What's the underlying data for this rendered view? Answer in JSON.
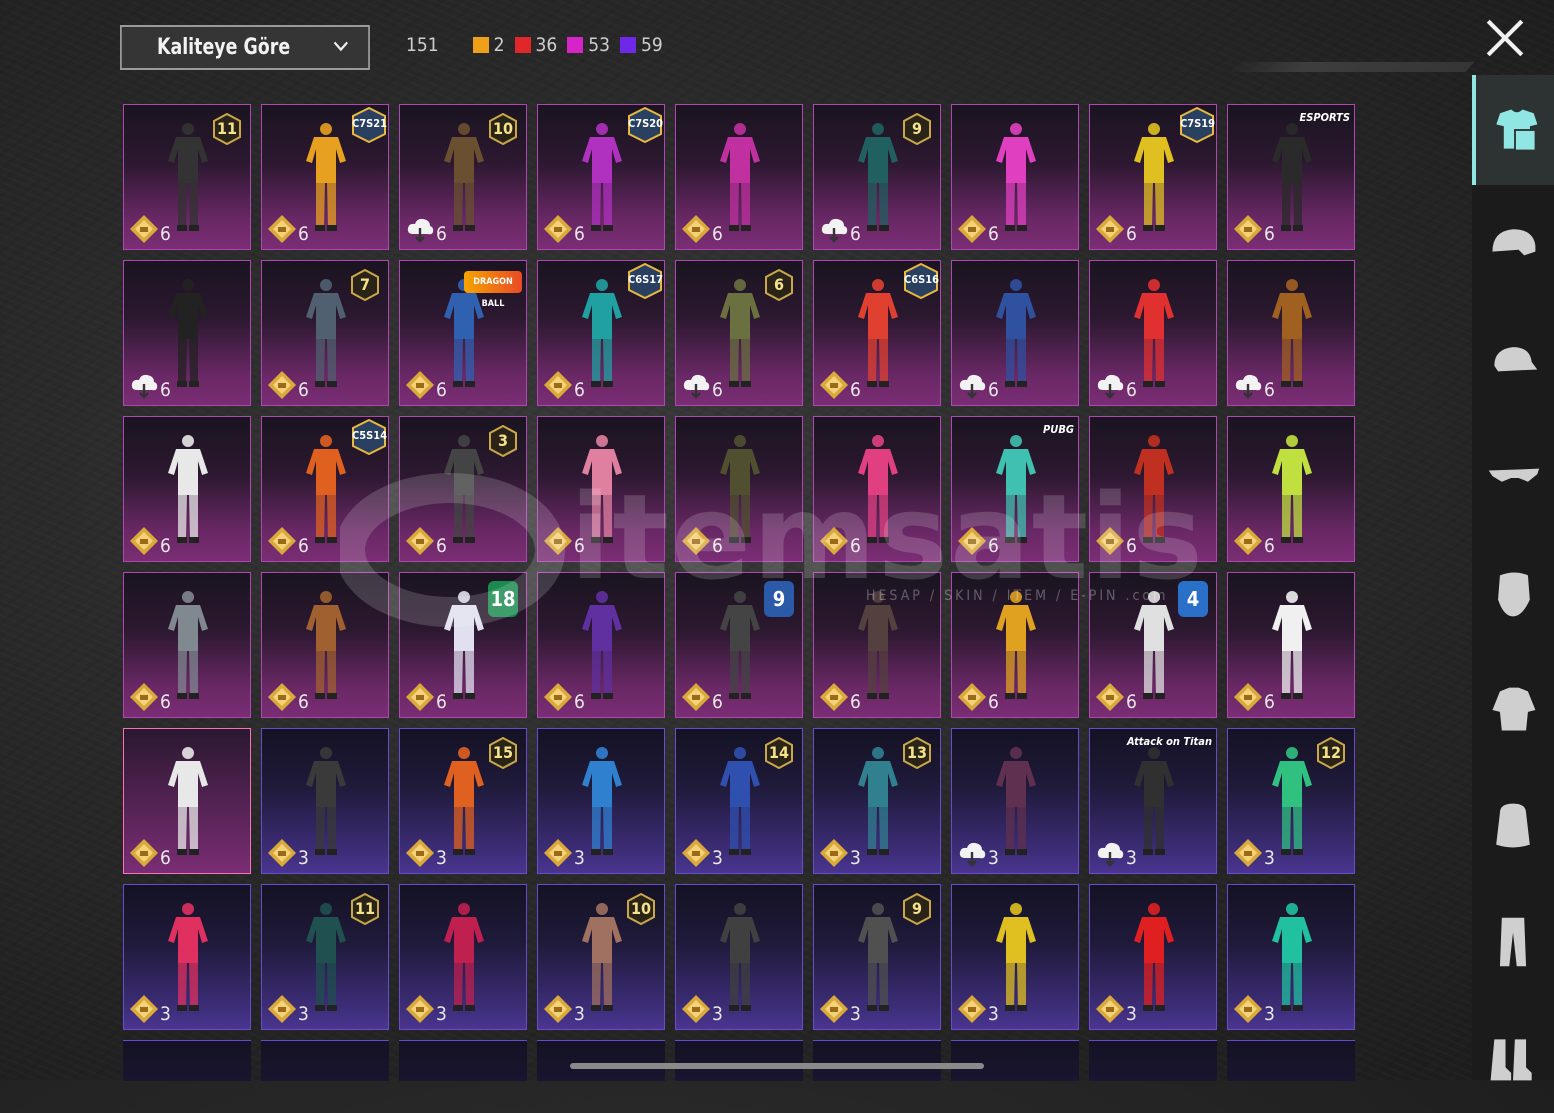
{
  "sort_dropdown": {
    "label": "Kaliteye Göre"
  },
  "counts": {
    "total": "151",
    "items": [
      {
        "value": "2",
        "color": "#f0a018"
      },
      {
        "value": "36",
        "color": "#e0282a"
      },
      {
        "value": "53",
        "color": "#d624c8"
      },
      {
        "value": "59",
        "color": "#7028e8"
      }
    ]
  },
  "watermark": {
    "brand": "itemsatis",
    "tagline": "HESAP / SKIN / ITEM / E-PIN .com"
  },
  "sidebar": {
    "items": [
      {
        "icon": "outfit-icon",
        "active": true
      },
      {
        "icon": "helmet-icon"
      },
      {
        "icon": "cap-icon"
      },
      {
        "icon": "glasses-icon"
      },
      {
        "icon": "mask-icon"
      },
      {
        "icon": "jacket-icon"
      },
      {
        "icon": "backpack-icon"
      },
      {
        "icon": "pants-icon"
      },
      {
        "icon": "shoes-icon"
      }
    ]
  },
  "tiles": [
    {
      "lvl": "6",
      "ind": "star",
      "rarity": "mythic",
      "badge": {
        "kind": "hex",
        "text": "11"
      },
      "color": "#333"
    },
    {
      "lvl": "6",
      "ind": "star",
      "rarity": "mythic",
      "badge": {
        "kind": "season",
        "text": "C7S21"
      },
      "color": "#e8a020"
    },
    {
      "lvl": "6",
      "ind": "cloud",
      "rarity": "mythic",
      "badge": {
        "kind": "hex",
        "text": "10"
      },
      "color": "#6a5030"
    },
    {
      "lvl": "6",
      "ind": "star",
      "rarity": "mythic",
      "badge": {
        "kind": "season",
        "text": "C7S20"
      },
      "color": "#b030c0"
    },
    {
      "lvl": "6",
      "ind": "star",
      "rarity": "mythic",
      "badge": null,
      "color": "#c030a0"
    },
    {
      "lvl": "6",
      "ind": "cloud",
      "rarity": "mythic",
      "badge": {
        "kind": "hex",
        "text": "9"
      },
      "color": "#206060"
    },
    {
      "lvl": "6",
      "ind": "star",
      "rarity": "mythic",
      "badge": null,
      "color": "#e040c0"
    },
    {
      "lvl": "6",
      "ind": "star",
      "rarity": "mythic",
      "badge": {
        "kind": "season",
        "text": "C7S19"
      },
      "color": "#e0c020"
    },
    {
      "lvl": "6",
      "ind": "star",
      "rarity": "mythic",
      "badge": {
        "kind": "text",
        "text": "ESPORTS"
      },
      "color": "#2a2a2a"
    },
    {
      "lvl": "6",
      "ind": "cloud",
      "rarity": "mythic",
      "badge": null,
      "color": "#222"
    },
    {
      "lvl": "6",
      "ind": "star",
      "rarity": "mythic",
      "badge": {
        "kind": "hex",
        "text": "7"
      },
      "color": "#506070"
    },
    {
      "lvl": "6",
      "ind": "star",
      "rarity": "mythic",
      "badge": {
        "kind": "logo",
        "text": "DRAGON BALL"
      },
      "color": "#3060b0"
    },
    {
      "lvl": "6",
      "ind": "star",
      "rarity": "mythic",
      "badge": {
        "kind": "season",
        "text": "C6S17"
      },
      "color": "#20a0a0"
    },
    {
      "lvl": "6",
      "ind": "cloud",
      "rarity": "mythic",
      "badge": {
        "kind": "hex",
        "text": "6"
      },
      "color": "#6a7040"
    },
    {
      "lvl": "6",
      "ind": "star",
      "rarity": "mythic",
      "badge": {
        "kind": "season",
        "text": "C6S16"
      },
      "color": "#e04030"
    },
    {
      "lvl": "6",
      "ind": "cloud",
      "rarity": "mythic",
      "badge": null,
      "color": "#3050a0"
    },
    {
      "lvl": "6",
      "ind": "cloud",
      "rarity": "mythic",
      "badge": null,
      "color": "#e03030"
    },
    {
      "lvl": "6",
      "ind": "cloud",
      "rarity": "mythic",
      "badge": null,
      "color": "#a06020"
    },
    {
      "lvl": "6",
      "ind": "star",
      "rarity": "mythic",
      "badge": null,
      "color": "#e8e8e8"
    },
    {
      "lvl": "6",
      "ind": "star",
      "rarity": "mythic",
      "badge": {
        "kind": "season",
        "text": "C5S14"
      },
      "color": "#e06020"
    },
    {
      "lvl": "6",
      "ind": "star",
      "rarity": "mythic",
      "badge": {
        "kind": "hex",
        "text": "3"
      },
      "color": "#444"
    },
    {
      "lvl": "6",
      "ind": "star",
      "rarity": "mythic",
      "badge": null,
      "color": "#e080a0"
    },
    {
      "lvl": "6",
      "ind": "star",
      "rarity": "mythic",
      "badge": null,
      "color": "#505030"
    },
    {
      "lvl": "6",
      "ind": "star",
      "rarity": "mythic",
      "badge": null,
      "color": "#e04080"
    },
    {
      "lvl": "6",
      "ind": "star",
      "rarity": "mythic",
      "badge": {
        "kind": "text",
        "text": "PUBG"
      },
      "color": "#40c0b0"
    },
    {
      "lvl": "6",
      "ind": "star",
      "rarity": "mythic",
      "badge": null,
      "color": "#c03020"
    },
    {
      "lvl": "6",
      "ind": "star",
      "rarity": "mythic",
      "badge": null,
      "color": "#c0e040"
    },
    {
      "lvl": "6",
      "ind": "star",
      "rarity": "mythic",
      "badge": null,
      "color": "#808890"
    },
    {
      "lvl": "6",
      "ind": "star",
      "rarity": "mythic",
      "badge": null,
      "color": "#a06030"
    },
    {
      "lvl": "6",
      "ind": "star",
      "rarity": "mythic",
      "badge": {
        "kind": "big",
        "text": "18",
        "color": "#1a8a50"
      },
      "color": "#e0e0f0"
    },
    {
      "lvl": "6",
      "ind": "star",
      "rarity": "mythic",
      "badge": null,
      "color": "#6030a0"
    },
    {
      "lvl": "6",
      "ind": "star",
      "rarity": "mythic",
      "badge": {
        "kind": "big",
        "text": "9",
        "color": "#2a5aa8"
      },
      "color": "#444"
    },
    {
      "lvl": "6",
      "ind": "star",
      "rarity": "mythic",
      "badge": null,
      "color": "#554040"
    },
    {
      "lvl": "6",
      "ind": "star",
      "rarity": "mythic",
      "badge": null,
      "color": "#e0a020"
    },
    {
      "lvl": "6",
      "ind": "star",
      "rarity": "mythic",
      "badge": {
        "kind": "big",
        "text": "4",
        "color": "#2a70c8"
      },
      "color": "#e0e0e0"
    },
    {
      "lvl": "6",
      "ind": "star",
      "rarity": "mythic",
      "badge": null,
      "color": "#f0f0f0"
    },
    {
      "lvl": "6",
      "ind": "star",
      "rarity": "selected",
      "badge": null,
      "color": "#e8e8e8"
    },
    {
      "lvl": "3",
      "ind": "star",
      "rarity": "legendary",
      "badge": null,
      "color": "#3a3a3a"
    },
    {
      "lvl": "3",
      "ind": "star",
      "rarity": "legendary",
      "badge": {
        "kind": "hex",
        "text": "15"
      },
      "color": "#e06020"
    },
    {
      "lvl": "3",
      "ind": "star",
      "rarity": "legendary",
      "badge": null,
      "color": "#3080d0"
    },
    {
      "lvl": "3",
      "ind": "star",
      "rarity": "legendary",
      "badge": {
        "kind": "hex",
        "text": "14"
      },
      "color": "#3050b0"
    },
    {
      "lvl": "3",
      "ind": "star",
      "rarity": "legendary",
      "badge": {
        "kind": "hex",
        "text": "13"
      },
      "color": "#308090"
    },
    {
      "lvl": "3",
      "ind": "cloud",
      "rarity": "legendary",
      "badge": null,
      "color": "#603050"
    },
    {
      "lvl": "3",
      "ind": "cloud",
      "rarity": "legendary",
      "badge": {
        "kind": "text",
        "text": "Attack on Titan"
      },
      "color": "#303030"
    },
    {
      "lvl": "3",
      "ind": "star",
      "rarity": "legendary",
      "badge": {
        "kind": "hex",
        "text": "12"
      },
      "color": "#30c080"
    },
    {
      "lvl": "3",
      "ind": "star",
      "rarity": "legendary",
      "badge": null,
      "color": "#e03060"
    },
    {
      "lvl": "3",
      "ind": "star",
      "rarity": "legendary",
      "badge": {
        "kind": "hex",
        "text": "11"
      },
      "color": "#205050"
    },
    {
      "lvl": "3",
      "ind": "star",
      "rarity": "legendary",
      "badge": null,
      "color": "#c02050"
    },
    {
      "lvl": "3",
      "ind": "star",
      "rarity": "legendary",
      "badge": {
        "kind": "hex",
        "text": "10"
      },
      "color": "#a07060"
    },
    {
      "lvl": "3",
      "ind": "star",
      "rarity": "legendary",
      "badge": null,
      "color": "#404040"
    },
    {
      "lvl": "3",
      "ind": "star",
      "rarity": "legendary",
      "badge": {
        "kind": "hex",
        "text": "9"
      },
      "color": "#505050"
    },
    {
      "lvl": "3",
      "ind": "star",
      "rarity": "legendary",
      "badge": null,
      "color": "#e0c020"
    },
    {
      "lvl": "3",
      "ind": "star",
      "rarity": "legendary",
      "badge": null,
      "color": "#e02020"
    },
    {
      "lvl": "3",
      "ind": "star",
      "rarity": "legendary",
      "badge": null,
      "color": "#20c0a0"
    }
  ]
}
